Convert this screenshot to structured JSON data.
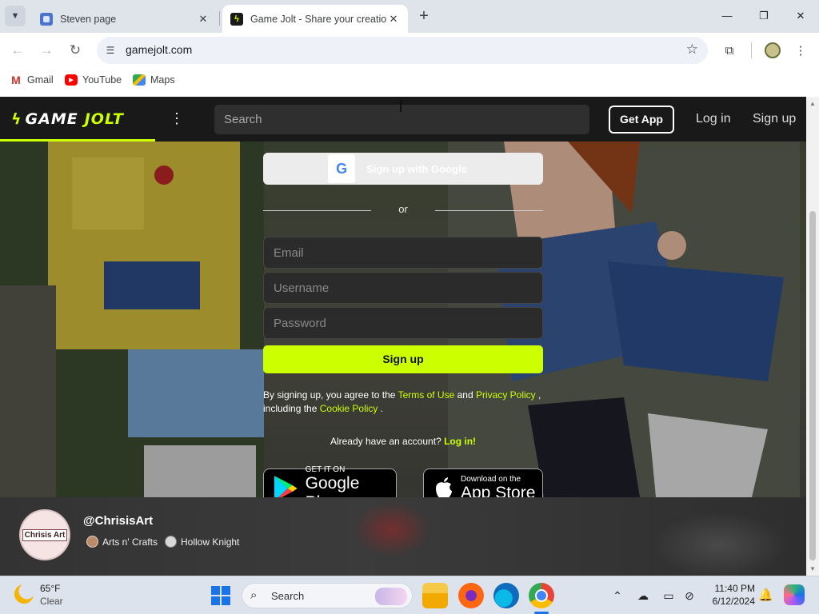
{
  "browser": {
    "tabs": [
      {
        "title": "Steven page",
        "active": false
      },
      {
        "title": "Game Jolt - Share your creation",
        "active": true
      }
    ],
    "tab_list_icon": "chevron-down-icon",
    "new_tab_icon": "plus-icon",
    "window_controls": {
      "minimize": "—",
      "maximize": "❐",
      "close": "✕"
    },
    "url": "gamejolt.com",
    "bookmarks": [
      {
        "label": "Gmail",
        "icon": "gmail-icon"
      },
      {
        "label": "YouTube",
        "icon": "youtube-icon"
      },
      {
        "label": "Maps",
        "icon": "maps-icon"
      }
    ]
  },
  "site": {
    "brand": {
      "word1": "GAME",
      "word2": "JOLT"
    },
    "search_placeholder": "Search",
    "get_app": "Get App",
    "login": "Log in",
    "signup": "Sign up",
    "accent": "#ccff00"
  },
  "form": {
    "google_label": "Sign up with Google",
    "or": "or",
    "email_placeholder": "Email",
    "username_placeholder": "Username",
    "password_placeholder": "Password",
    "submit": "Sign up",
    "terms_prefix": "By signing up, you agree to the",
    "terms_link": "Terms of Use",
    "terms_and": "and",
    "privacy_link": "Privacy Policy",
    "terms_mid": ", including the",
    "cookie_link": "Cookie Policy",
    "terms_end": ".",
    "have_account": "Already have an account?",
    "login_link": "Log in!"
  },
  "stores": {
    "google": {
      "small": "GET IT ON",
      "big": "Google Play"
    },
    "apple": {
      "small": "Download on the",
      "big": "App Store"
    }
  },
  "featured": {
    "avatar_text": "Chrisis Art",
    "username": "@ChrisisArt",
    "tags": [
      "Arts n' Crafts",
      "Hollow Knight"
    ]
  },
  "taskbar": {
    "weather_temp": "65°F",
    "weather_cond": "Clear",
    "search_label": "Search",
    "time": "11:40 PM",
    "date": "6/12/2024"
  }
}
